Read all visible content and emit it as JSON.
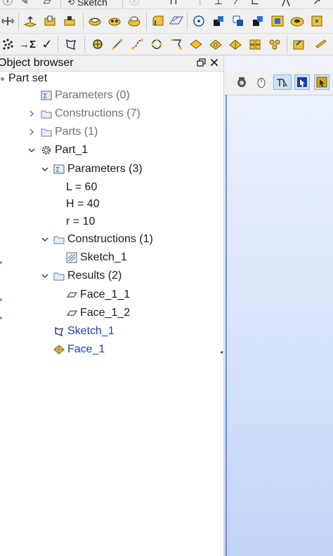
{
  "toolbar": {
    "sketch_tab_label": "Sketch",
    "row2_icons": [
      "move-icon",
      "extrusion-icon",
      "extrusion-cut-icon",
      "extrusion-fuse-icon",
      "revolution-icon",
      "revolution-cut-icon",
      "revolution-fuse-icon",
      "fillet-icon",
      "chamfer-icon",
      "translation-icon",
      "rotation-icon",
      "scale-icon",
      "placement-icon",
      "partition-icon",
      "fuse-icon",
      "smash-icon",
      "recover-icon"
    ],
    "row3_icons": [
      "point-cloud-icon",
      "parameter-icon",
      "check-icon",
      "sketch-icon",
      "point-icon",
      "line-icon",
      "polyline-icon",
      "circle-icon",
      "wire-icon",
      "face-icon",
      "shell-icon",
      "solid-icon",
      "compsolid-icon",
      "compound-icon",
      "import-icon",
      "export-icon"
    ]
  },
  "browser": {
    "title": "Object browser",
    "root_label": "Part set",
    "items": [
      {
        "label": "Parameters (0)",
        "style": "grey",
        "icon": "parameters-icon"
      },
      {
        "label": "Constructions (7)",
        "style": "grey",
        "icon": "folder-icon"
      },
      {
        "label": "Parts (1)",
        "style": "grey",
        "icon": "folder-icon"
      },
      {
        "label": "Part_1",
        "style": "normal",
        "icon": "gear-icon"
      },
      {
        "label": "Parameters (3)",
        "style": "normal",
        "icon": "parameters-icon"
      },
      {
        "label": "L = 60",
        "style": "normal"
      },
      {
        "label": "H = 40",
        "style": "normal"
      },
      {
        "label": "r = 10",
        "style": "normal"
      },
      {
        "label": "Constructions (1)",
        "style": "normal",
        "icon": "folder-icon"
      },
      {
        "label": "Sketch_1",
        "style": "normal",
        "icon": "sketch-icon"
      },
      {
        "label": "Results (2)",
        "style": "normal",
        "icon": "folder-icon"
      },
      {
        "label": "Face_1_1",
        "style": "normal",
        "icon": "face-icon"
      },
      {
        "label": "Face_1_2",
        "style": "normal",
        "icon": "face-icon"
      },
      {
        "label": "Sketch_1",
        "style": "blue",
        "icon": "sketch-feature-icon"
      },
      {
        "label": "Face_1",
        "style": "blue",
        "icon": "face-feature-icon"
      }
    ]
  },
  "viewer": {
    "toolbar_icons": [
      "camera-icon",
      "mouse-icon",
      "select-icon",
      "select-vertex-icon",
      "select-face-icon"
    ]
  },
  "colors": {
    "link_blue": "#1a3fc0",
    "viewer_bg_top": "#eef3fc",
    "viewer_bg_bottom": "#c2d4f7"
  }
}
